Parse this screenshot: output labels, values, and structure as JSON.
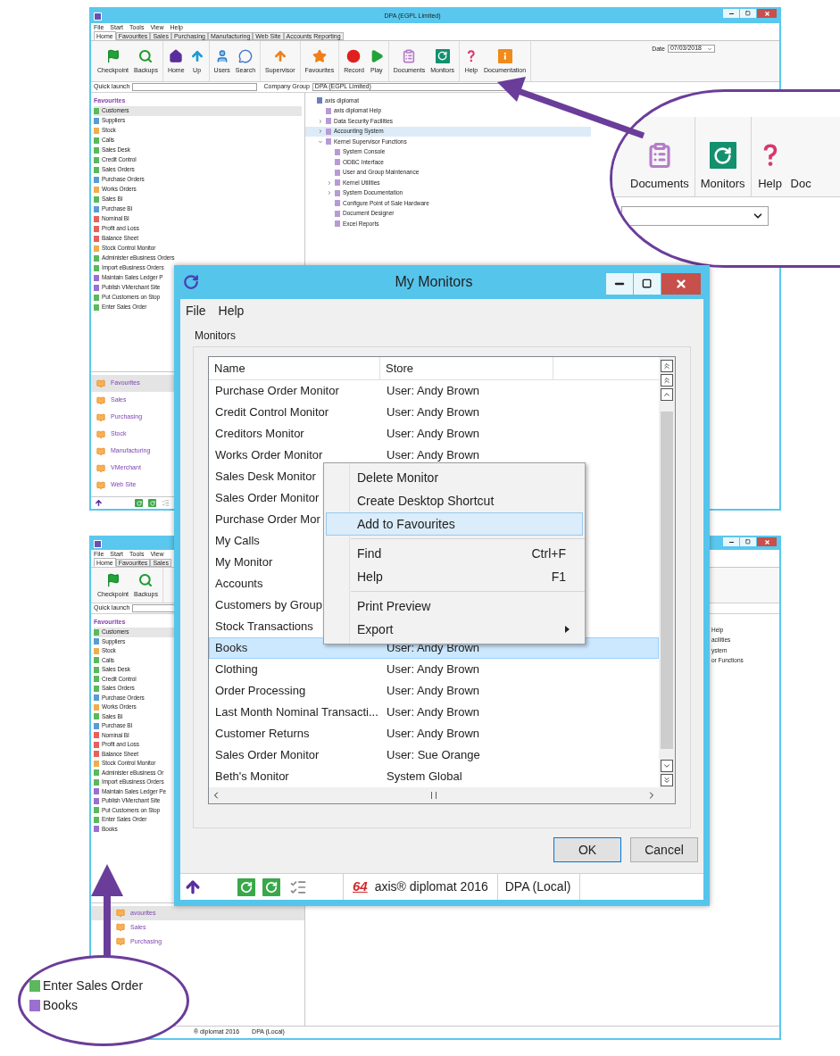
{
  "main_window": {
    "title": "DPA (EGPL Limited)",
    "menu": [
      "File",
      "Start",
      "Tools",
      "View",
      "Help"
    ],
    "tabs": [
      {
        "label": "Home",
        "selected": true
      },
      {
        "label": "Favourites",
        "selected": false
      },
      {
        "label": "Sales",
        "selected": false
      },
      {
        "label": "Purchasing",
        "selected": false
      },
      {
        "label": "Manufacturing",
        "selected": false
      },
      {
        "label": "Web Site",
        "selected": false
      },
      {
        "label": "Accounts Reporting",
        "selected": false
      }
    ],
    "ribbon": [
      [
        "Checkpoint",
        "Backups"
      ],
      [
        "Home",
        "Up"
      ],
      [
        "Users",
        "Search"
      ],
      [
        "Supervisor"
      ],
      [
        "Favourites"
      ],
      [
        "Record",
        "Play"
      ],
      [
        "Documents",
        "Monitors"
      ],
      [
        "Help",
        "Documentation"
      ]
    ],
    "date": {
      "label": "Date",
      "value": "07/03/2018"
    },
    "quick_launch": {
      "label": "Quick launch"
    },
    "company_group": {
      "label": "Company Group",
      "value": "DPA (EGPL Limited)"
    },
    "favourites": {
      "title": "Favourites",
      "items": [
        {
          "label": "Customers",
          "color": "#5cb85c",
          "selected": true
        },
        {
          "label": "Suppliers",
          "color": "#5b9bd5",
          "selected": false
        },
        {
          "label": "Stock",
          "color": "#f0ad4e",
          "selected": false
        },
        {
          "label": "Calls",
          "color": "#5cb85c",
          "selected": false
        },
        {
          "label": "Sales Desk",
          "color": "#5cb85c",
          "selected": false
        },
        {
          "label": "Credit Control",
          "color": "#5cb85c",
          "selected": false
        },
        {
          "label": "Sales Orders",
          "color": "#5cb85c",
          "selected": false
        },
        {
          "label": "Purchase Orders",
          "color": "#5b9bd5",
          "selected": false
        },
        {
          "label": "Works Orders",
          "color": "#f0ad4e",
          "selected": false
        },
        {
          "label": "Sales BI",
          "color": "#5cb85c",
          "selected": false
        },
        {
          "label": "Purchase BI",
          "color": "#5b9bd5",
          "selected": false
        },
        {
          "label": "Nominal BI",
          "color": "#e8605a",
          "selected": false
        },
        {
          "label": "Profit and Loss",
          "color": "#e8605a",
          "selected": false
        },
        {
          "label": "Balance Sheet",
          "color": "#e8605a",
          "selected": false
        },
        {
          "label": "Stock Control Monitor",
          "color": "#f0ad4e",
          "selected": false
        },
        {
          "label": "Administer eBusiness Orders",
          "color": "#5cb85c",
          "selected": false
        },
        {
          "label": "Import eBusiness Orders",
          "color": "#5cb85c",
          "selected": false
        },
        {
          "label": "Maintain Sales Ledger P",
          "color": "#9b6fd0",
          "selected": false
        },
        {
          "label": "Publish VMerchant Site",
          "color": "#9b6fd0",
          "selected": false
        },
        {
          "label": "Put Customers on Stop",
          "color": "#5cb85c",
          "selected": false
        },
        {
          "label": "Enter Sales Order",
          "color": "#5cb85c",
          "selected": false
        }
      ]
    },
    "navigator": [
      {
        "label": "Favourites",
        "selected": true
      },
      {
        "label": "Sales",
        "selected": false
      },
      {
        "label": "Purchasing",
        "selected": false
      },
      {
        "label": "Stock",
        "selected": false
      },
      {
        "label": "Manufacturing",
        "selected": false
      },
      {
        "label": "VMerchant",
        "selected": false
      },
      {
        "label": "Web Site",
        "selected": false
      }
    ],
    "tree": [
      {
        "label": "axis diplomat",
        "selected": false,
        "children": [
          {
            "label": "axis diplomat Help",
            "selected": false
          },
          {
            "label": "Data Security Facilities",
            "selected": false,
            "expanded": false
          },
          {
            "label": "Accounting System",
            "selected": true,
            "expanded": false
          },
          {
            "label": "Kernel Supervisor Functions",
            "selected": false,
            "expanded": true,
            "children": [
              {
                "label": "System Console",
                "selected": false
              },
              {
                "label": "ODBC Interface",
                "selected": false
              },
              {
                "label": "User and Group Maintenance",
                "selected": false
              },
              {
                "label": "Kernel Utilities",
                "selected": false,
                "expanded": false
              },
              {
                "label": "System Documentation",
                "selected": false,
                "expanded": false
              },
              {
                "label": "Configure Point of Sale Hardware",
                "selected": false
              },
              {
                "label": "Document Designer",
                "selected": false
              },
              {
                "label": "Excel Reports",
                "selected": false
              }
            ]
          }
        ]
      }
    ]
  },
  "callout_top": {
    "buttons": [
      "Documents",
      "Monitors",
      "Help",
      "Doc"
    ]
  },
  "second_window": {
    "menu": [
      "File",
      "Start",
      "Tools",
      "View"
    ],
    "tabs": [
      {
        "label": "Home",
        "selected": true
      },
      {
        "label": "Favourites",
        "selected": false
      },
      {
        "label": "Sales",
        "selected": false
      }
    ],
    "ribbon": [
      [
        "Checkpoint",
        "Backups"
      ]
    ],
    "quick_launch": {
      "label": "Quick launch"
    },
    "favourites": {
      "title": "Favourites",
      "items": [
        {
          "label": "Customers",
          "color": "#5cb85c",
          "selected": true
        },
        {
          "label": "Suppliers",
          "color": "#5b9bd5",
          "selected": false
        },
        {
          "label": "Stock",
          "color": "#f0ad4e",
          "selected": false
        },
        {
          "label": "Calls",
          "color": "#5cb85c",
          "selected": false
        },
        {
          "label": "Sales Desk",
          "color": "#5cb85c",
          "selected": false
        },
        {
          "label": "Credit Control",
          "color": "#5cb85c",
          "selected": false
        },
        {
          "label": "Sales Orders",
          "color": "#5cb85c",
          "selected": false
        },
        {
          "label": "Purchase Orders",
          "color": "#5b9bd5",
          "selected": false
        },
        {
          "label": "Works Orders",
          "color": "#f0ad4e",
          "selected": false
        },
        {
          "label": "Sales BI",
          "color": "#5cb85c",
          "selected": false
        },
        {
          "label": "Purchase BI",
          "color": "#5b9bd5",
          "selected": false
        },
        {
          "label": "Nominal BI",
          "color": "#e8605a",
          "selected": false
        },
        {
          "label": "Profit and Loss",
          "color": "#e8605a",
          "selected": false
        },
        {
          "label": "Balance Sheet",
          "color": "#e8605a",
          "selected": false
        },
        {
          "label": "Stock Control Monitor",
          "color": "#f0ad4e",
          "selected": false
        },
        {
          "label": "Administer eBusiness Or",
          "color": "#5cb85c",
          "selected": false
        },
        {
          "label": "Import eBusiness Orders",
          "color": "#5cb85c",
          "selected": false
        },
        {
          "label": "Maintain Sales Ledger Pe",
          "color": "#9b6fd0",
          "selected": false
        },
        {
          "label": "Publish VMerchant Site",
          "color": "#9b6fd0",
          "selected": false
        },
        {
          "label": "Put Customers on Stop",
          "color": "#5cb85c",
          "selected": false
        },
        {
          "label": "Enter Sales Order",
          "color": "#5cb85c",
          "selected": false
        },
        {
          "label": "Books",
          "color": "#9b6fd0",
          "selected": false
        }
      ]
    },
    "navigator": [
      {
        "label": "avourites",
        "selected": true
      },
      {
        "label": "Sales",
        "selected": false
      },
      {
        "label": "Purchasing",
        "selected": false
      }
    ],
    "tree_fragments": [
      "Help",
      "acilities",
      "ystem",
      "or Functions"
    ],
    "status": [
      "® diplomat 2016",
      "DPA (Local)"
    ]
  },
  "dialog": {
    "title": "My Monitors",
    "menu": [
      "File",
      "Help"
    ],
    "group": "Monitors",
    "columns": [
      "Name",
      "Store"
    ],
    "rows": [
      {
        "name": "Purchase Order Monitor",
        "store": "User: Andy Brown",
        "selected": false
      },
      {
        "name": "Credit Control Monitor",
        "store": "User: Andy Brown",
        "selected": false
      },
      {
        "name": "Creditors Monitor",
        "store": "User: Andy Brown",
        "selected": false
      },
      {
        "name": "Works Order Monitor",
        "store": "User: Andy Brown",
        "selected": false
      },
      {
        "name": "Sales Desk Monitor",
        "selected": false
      },
      {
        "name": "Sales Order Monitor",
        "selected": false
      },
      {
        "name": "Purchase Order Mor",
        "selected": false
      },
      {
        "name": "My Calls",
        "selected": false
      },
      {
        "name": "My Monitor",
        "selected": false
      },
      {
        "name": "Accounts",
        "selected": false
      },
      {
        "name": "Customers by Group",
        "selected": false
      },
      {
        "name": "Stock Transactions",
        "selected": false
      },
      {
        "name": "Books",
        "store": "User: Andy Brown",
        "selected": true
      },
      {
        "name": "Clothing",
        "store": "User: Andy Brown",
        "selected": false
      },
      {
        "name": "Order Processing",
        "store": "User: Andy Brown",
        "selected": false
      },
      {
        "name": "Last Month Nominal Transacti...",
        "store": "User: Andy Brown",
        "selected": false
      },
      {
        "name": "Customer Returns",
        "store": "User: Andy Brown",
        "selected": false
      },
      {
        "name": "Sales Order Monitor",
        "store": "User: Sue Orange",
        "selected": false
      },
      {
        "name": "Beth's Monitor",
        "store": "System Global",
        "selected": false
      }
    ],
    "buttons": [
      "OK",
      "Cancel"
    ],
    "status": {
      "logo": "64",
      "product": "axis® diplomat 2016",
      "company": "DPA (Local)"
    }
  },
  "context_menu": [
    {
      "kind": "item",
      "label": "Delete Monitor",
      "selected": false,
      "submenu": false
    },
    {
      "kind": "item",
      "label": "Create Desktop Shortcut",
      "selected": false,
      "submenu": false
    },
    {
      "kind": "item",
      "label": "Add to Favourites",
      "selected": true,
      "submenu": false
    },
    {
      "kind": "separator"
    },
    {
      "kind": "item",
      "label": "Find",
      "shortcut": "Ctrl+F",
      "selected": false,
      "submenu": false
    },
    {
      "kind": "item",
      "label": "Help",
      "shortcut": "F1",
      "selected": false,
      "submenu": false
    },
    {
      "kind": "separator"
    },
    {
      "kind": "item",
      "label": "Print Preview",
      "selected": false,
      "submenu": false
    },
    {
      "kind": "item",
      "label": "Export",
      "selected": false,
      "submenu": true
    }
  ],
  "callout_bottom": {
    "items": [
      {
        "label": "Enter Sales Order",
        "color": "#5cb85c"
      },
      {
        "label": "Books",
        "color": "#9b6fd0"
      }
    ]
  }
}
